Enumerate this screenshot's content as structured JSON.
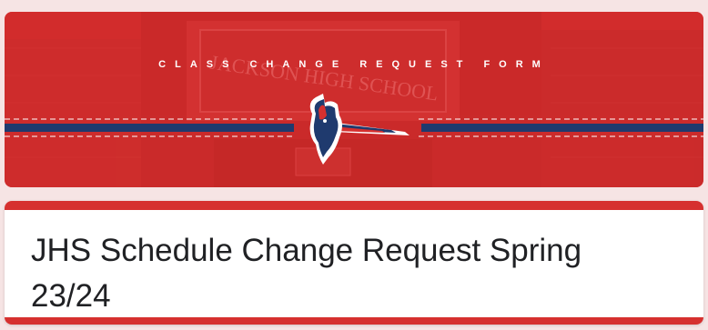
{
  "banner": {
    "title": "CLASS CHANGE REQUEST FORM",
    "building_sign": "JACKSON HIGH SCHOOL",
    "mascot": "patriot-mascot-logo"
  },
  "form": {
    "title": "JHS Schedule Change Request Spring 23/24"
  },
  "colors": {
    "primary_red": "#d6302f",
    "navy": "#1f3a6e",
    "background": "#f6e4e4"
  }
}
